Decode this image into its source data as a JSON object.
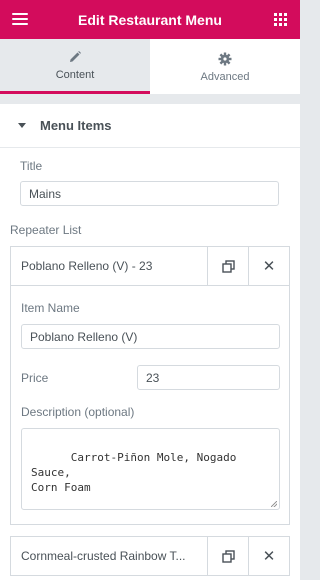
{
  "header": {
    "title": "Edit Restaurant Menu",
    "menu_icon": "hamburger-icon",
    "apps_icon": "grid-icon",
    "accent": "#d30c5c"
  },
  "tabs": [
    {
      "label": "Content",
      "icon": "pencil-icon",
      "active": true
    },
    {
      "label": "Advanced",
      "icon": "gear-icon",
      "active": false
    }
  ],
  "section": {
    "label": "Menu Items"
  },
  "title_field": {
    "label": "Title",
    "value": "Mains"
  },
  "repeater": {
    "label": "Repeater List",
    "items": [
      {
        "title": "Poblano Relleno (V) - 23",
        "expanded": true,
        "fields": {
          "name_label": "Item Name",
          "name_value": "Poblano Relleno (V)",
          "price_label": "Price",
          "price_value": "23",
          "description_label": "Description (optional)",
          "description_value": "Carrot-Piñon Mole, Nogado Sauce,\nCorn Foam"
        }
      },
      {
        "title": "Cornmeal-crusted Rainbow T...",
        "expanded": false
      }
    ],
    "duplicate_icon": "duplicate-icon",
    "remove_icon": "close-icon"
  }
}
